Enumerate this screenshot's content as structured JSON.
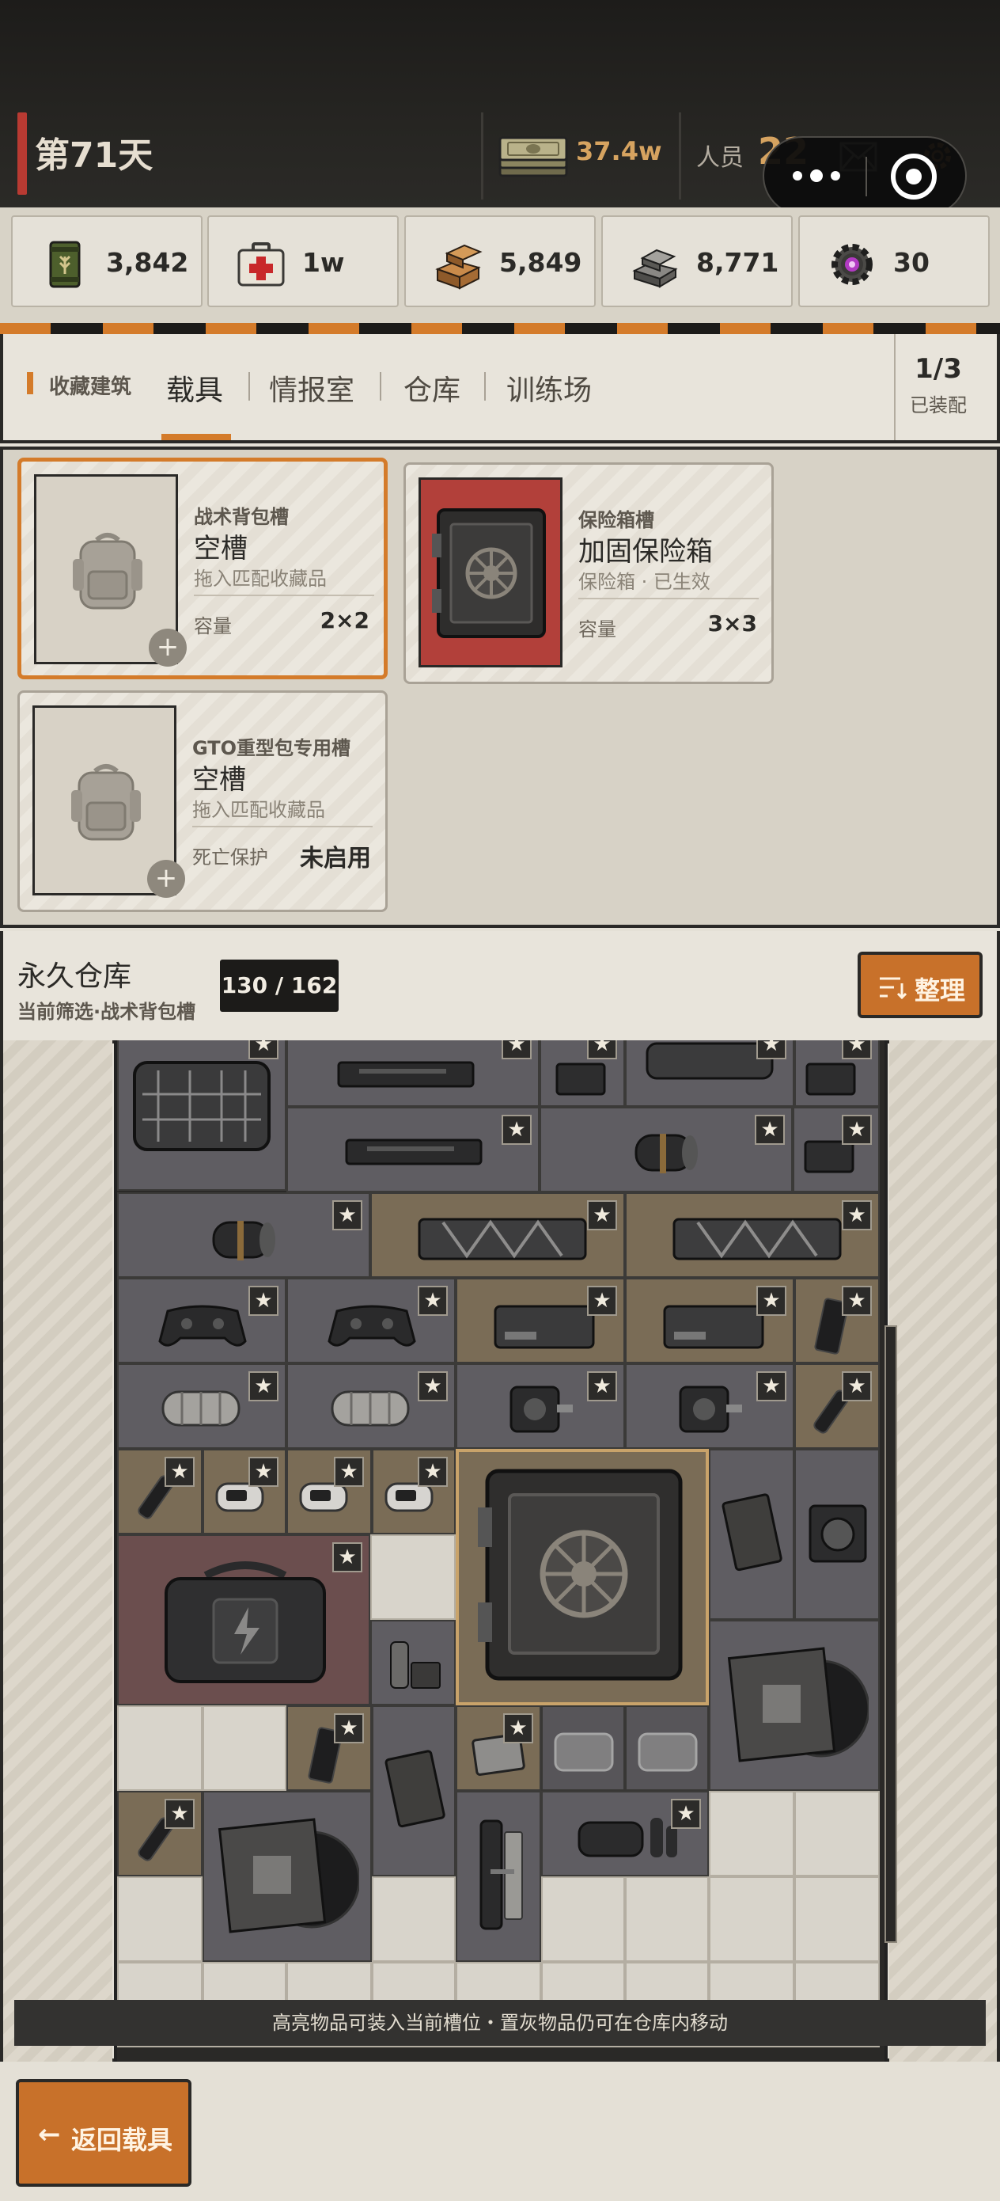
{
  "header": {
    "day_label": "第71天",
    "money_value": "37.4w",
    "people_label": "人员",
    "people_value": "22"
  },
  "resources": [
    {
      "icon": "wheat-crate-icon",
      "value": "3,842"
    },
    {
      "icon": "medkit-icon",
      "value": "1w"
    },
    {
      "icon": "wood-planks-icon",
      "value": "5,849"
    },
    {
      "icon": "metal-ingots-icon",
      "value": "8,771"
    },
    {
      "icon": "gear-core-icon",
      "value": "30"
    }
  ],
  "nav": {
    "favorite_label": "收藏建筑",
    "tabs": [
      {
        "label": "载具",
        "active": true
      },
      {
        "label": "情报室"
      },
      {
        "label": "仓库"
      },
      {
        "label": "训练场"
      }
    ],
    "slot_count": "1/3",
    "slot_label": "已装配"
  },
  "slots": [
    {
      "category": "战术背包槽",
      "name": "空槽",
      "hint": "拖入匹配收藏品",
      "prop_label": "容量",
      "prop_value": "2×2",
      "selected": true
    },
    {
      "category": "保险箱槽",
      "name": "加固保险箱",
      "hint": "保险箱 · 已生效",
      "prop_label": "容量",
      "prop_value": "3×3"
    },
    {
      "category": "GTO重型包专用槽",
      "name": "空槽",
      "hint": "拖入匹配收藏品",
      "prop_label": "死亡保护",
      "prop_value": "未启用"
    }
  ],
  "warehouse": {
    "title": "永久仓库",
    "filter": "当前筛选·战术背包槽",
    "count": "130 / 162",
    "sort_label": "整理",
    "tip": "高亮物品可装入当前槽位・置灰物品仍可在仓库内移动"
  },
  "footer": {
    "back_label": "返回载具"
  },
  "colors": {
    "accent": "#d47b2a",
    "danger": "#b83a32",
    "dark": "#2a2927",
    "panel": "#e8e4db"
  }
}
